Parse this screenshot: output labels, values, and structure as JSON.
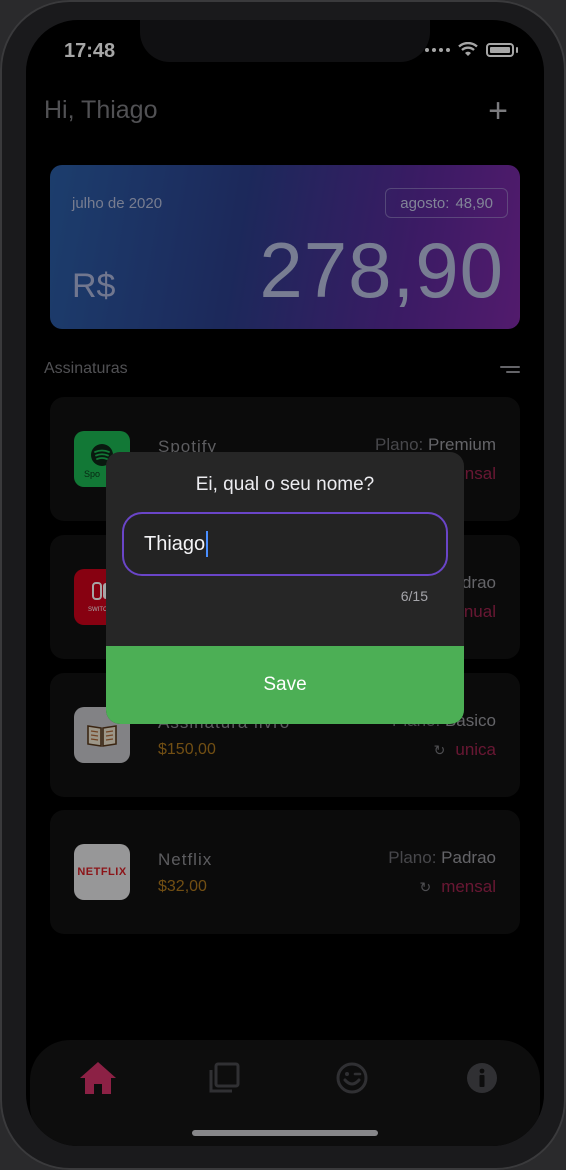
{
  "status_bar": {
    "time": "17:48"
  },
  "header": {
    "greeting": "Hi, Thiago"
  },
  "balance_card": {
    "month": "julho de 2020",
    "next_label": "agosto:",
    "next_value": "48,90",
    "currency": "R$",
    "amount": "278,90"
  },
  "subscriptions": {
    "title": "Assinaturas",
    "items": [
      {
        "name": "Spotify",
        "price": "",
        "plan_label": "Plano:",
        "plan": "Premium",
        "period": "mensal",
        "logo_text": "Spo"
      },
      {
        "name": "",
        "price": "",
        "plan_label": "",
        "plan": "Padrao",
        "period": "anual",
        "logo_text": "SWITCH"
      },
      {
        "name": "Assinatura livro",
        "price": "$150,00",
        "plan_label": "Plano:",
        "plan": "Basico",
        "period": "unica",
        "logo_text": ""
      },
      {
        "name": "Netflix",
        "price": "$32,00",
        "plan_label": "Plano:",
        "plan": "Padrao",
        "period": "mensal",
        "logo_text": "NETFLIX"
      }
    ]
  },
  "dialog": {
    "title": "Ei, qual o seu nome?",
    "input_value": "Thiago",
    "counter": "6/15",
    "save_label": "Save"
  },
  "tab_bar": {
    "items": [
      {
        "icon": "home-icon",
        "active": true
      },
      {
        "icon": "copy-icon",
        "active": false
      },
      {
        "icon": "smile-icon",
        "active": false
      },
      {
        "icon": "info-icon",
        "active": false
      }
    ]
  },
  "colors": {
    "accent_purple": "#6a45c8",
    "save_green": "#4caf55",
    "period_pink": "#a0244f",
    "price_orange": "#b07a1e",
    "active_tab": "#d8336a"
  }
}
